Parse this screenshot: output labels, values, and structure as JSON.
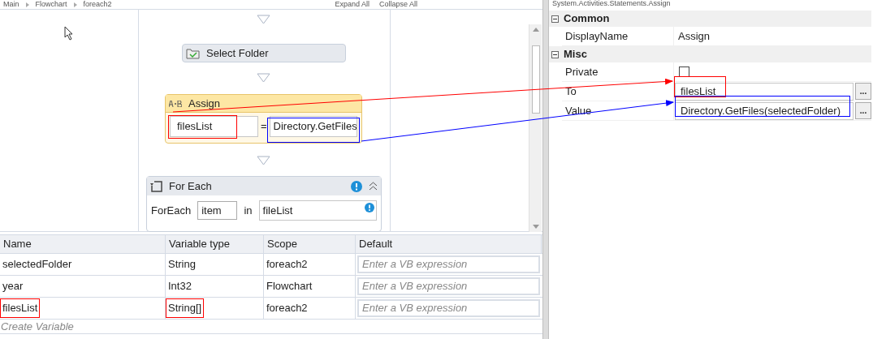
{
  "breadcrumb": [
    "Main",
    "Flowchart",
    "foreach2"
  ],
  "designer_actions": [
    "Expand All",
    "Collapse All"
  ],
  "flowchart": {
    "activities": [
      {
        "kind": "simple",
        "title": "Select Folder"
      },
      {
        "kind": "assign",
        "title": "Assign",
        "to": "filesList",
        "equals": "=",
        "value": "Directory.GetFiles"
      },
      {
        "kind": "foreach",
        "title": "For Each",
        "label": "ForEach",
        "item": "item",
        "in_label": "in",
        "collection": "fileList"
      }
    ]
  },
  "variables": {
    "columns": [
      "Name",
      "Variable type",
      "Scope",
      "Default"
    ],
    "rows": [
      {
        "name": "selectedFolder",
        "type": "String",
        "scope": "foreach2",
        "placeholder": "Enter a VB expression",
        "highlight_name": false,
        "highlight_type": false
      },
      {
        "name": "year",
        "type": "Int32",
        "scope": "Flowchart",
        "placeholder": "Enter a VB expression",
        "highlight_name": false,
        "highlight_type": false
      },
      {
        "name": "filesList",
        "type": "String[]",
        "scope": "foreach2",
        "placeholder": "Enter a VB expression",
        "highlight_name": true,
        "highlight_type": true
      }
    ],
    "create": "Create Variable"
  },
  "properties": {
    "title": "System.Activities.Statements.Assign",
    "categories": [
      {
        "name": "Common",
        "expanded": true,
        "rows": [
          {
            "kind": "text",
            "label": "DisplayName",
            "value": "Assign"
          }
        ]
      },
      {
        "name": "Misc",
        "expanded": true,
        "rows": [
          {
            "kind": "checkbox",
            "label": "Private",
            "checked": false
          },
          {
            "kind": "expression",
            "label": "To",
            "value": "filesList",
            "button": "..."
          },
          {
            "kind": "expression",
            "label": "Value",
            "value": "Directory.GetFiles(selectedFolder)",
            "button": "..."
          }
        ]
      }
    ]
  }
}
